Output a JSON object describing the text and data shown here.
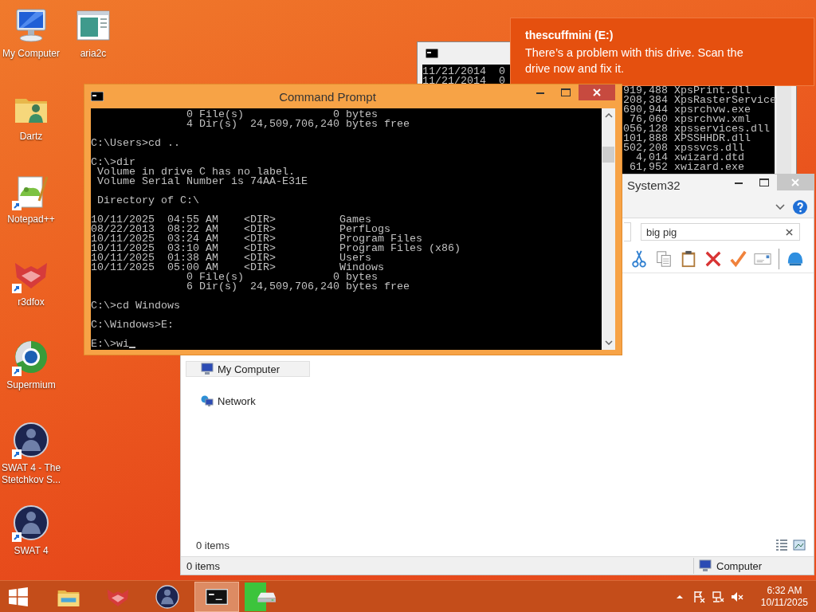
{
  "desktop_icons": [
    {
      "label": "My Computer",
      "kind": "computer",
      "shortcut": false
    },
    {
      "label": "Dartz",
      "kind": "user-folder",
      "shortcut": false
    },
    {
      "label": "Notepad++",
      "kind": "notepad",
      "shortcut": true
    },
    {
      "label": "r3dfox",
      "kind": "fox",
      "shortcut": true
    },
    {
      "label": "Supermium",
      "kind": "browser",
      "shortcut": true
    },
    {
      "label": "SWAT 4 - The Stetchkov S...",
      "kind": "game",
      "shortcut": true
    },
    {
      "label": "SWAT 4",
      "kind": "game",
      "shortcut": true
    },
    {
      "label": "aria2c",
      "kind": "app-window",
      "shortcut": false
    }
  ],
  "back_console": {
    "left_lines": [
      "11/21/2014  0",
      "11/21/2014  0"
    ],
    "right_lines": [
      "919,488 XpsPrint.dll",
      "208,384 XpsRasterService",
      "690,944 xpsrchvw.exe",
      " 76,060 xpsrchvw.xml",
      "056,128 xpsservices.dll",
      "101,888 XPSSHHDR.dll",
      "502,208 xpssvcs.dll",
      "  4,014 xwizard.dtd",
      " 61,952 xwizard.exe"
    ]
  },
  "notification": {
    "title": "thescuffmini (E:)",
    "message": "There’s a problem with this drive.  Scan the drive now and fix it."
  },
  "explorer": {
    "title": "System32",
    "search": {
      "value": "big pig"
    },
    "toolbar": [
      {
        "kind": "cut"
      },
      {
        "kind": "copy"
      },
      {
        "kind": "paste"
      },
      {
        "kind": "delete"
      },
      {
        "kind": "check"
      },
      {
        "kind": "mail"
      },
      {
        "kind": "shell"
      }
    ],
    "nav_items": [
      {
        "label": "My Computer",
        "kind": "computer",
        "selected": true
      },
      {
        "label": "Network",
        "kind": "network",
        "selected": false
      }
    ],
    "item_count": "0 items",
    "status_bar": {
      "count": "0 items",
      "location": "Computer"
    }
  },
  "console": {
    "title": "Command Prompt",
    "blocks": [
      [
        "               0 File(s)              0 bytes",
        "               4 Dir(s)  24,509,706,240 bytes free"
      ],
      [
        "C:\\Users>cd .."
      ],
      [
        "C:\\>dir",
        " Volume in drive C has no label.",
        " Volume Serial Number is 74AA-E31E"
      ],
      [
        " Directory of C:\\"
      ],
      [
        "10/11/2025  04:55 AM    <DIR>          Games",
        "08/22/2013  08:22 AM    <DIR>          PerfLogs",
        "10/11/2025  03:24 AM    <DIR>          Program Files",
        "10/11/2025  03:10 AM    <DIR>          Program Files (x86)",
        "10/11/2025  01:38 AM    <DIR>          Users",
        "10/11/2025  05:00 AM    <DIR>          Windows",
        "               0 File(s)              0 bytes",
        "               6 Dir(s)  24,509,706,240 bytes free"
      ],
      [
        "C:\\>cd Windows"
      ],
      [
        "C:\\Windows>E:"
      ]
    ],
    "input": "E:\\>wi"
  },
  "taskbar": {
    "items": [
      {
        "kind": "explorer",
        "active": false
      },
      {
        "kind": "fox",
        "active": false
      },
      {
        "kind": "game",
        "active": false
      },
      {
        "kind": "console",
        "active": true
      },
      {
        "kind": "drive",
        "active": false,
        "level": 0.5
      }
    ],
    "tray": [
      {
        "kind": "chevron"
      },
      {
        "kind": "flag"
      },
      {
        "kind": "network"
      },
      {
        "kind": "muted"
      }
    ],
    "clock": {
      "time": "6:32 AM",
      "date": "10/11/2025"
    }
  }
}
